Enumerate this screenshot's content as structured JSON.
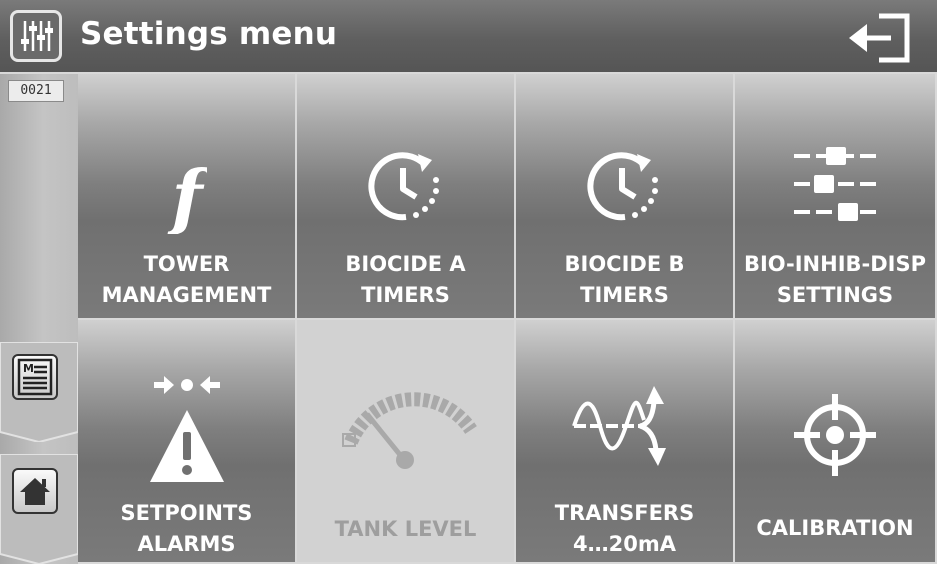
{
  "header": {
    "title": "Settings menu",
    "icon": "mixer-sliders-icon",
    "exit_icon": "exit-arrow-icon"
  },
  "sidebar": {
    "counter": "0021",
    "buttons": [
      {
        "icon": "manual-book-icon"
      },
      {
        "icon": "home-icon"
      }
    ]
  },
  "tiles": [
    {
      "line1": "TOWER",
      "line2": "MANAGEMENT",
      "icon": "function-f-icon",
      "enabled": true
    },
    {
      "line1": "BIOCIDE A",
      "line2": "TIMERS",
      "icon": "clock-timer-icon",
      "enabled": true
    },
    {
      "line1": "BIOCIDE B",
      "line2": "TIMERS",
      "icon": "clock-timer-icon",
      "enabled": true
    },
    {
      "line1": "BIO-INHIB-DISP",
      "line2": "SETTINGS",
      "icon": "sliders-icon",
      "enabled": true
    },
    {
      "line1": "SETPOINTS",
      "line2": "ALARMS",
      "icon": "warning-setpoint-icon",
      "enabled": true
    },
    {
      "line1": "TANK LEVEL",
      "line2": "",
      "icon": "gauge-icon",
      "enabled": false
    },
    {
      "line1": "TRANSFERS",
      "line2": "4…20mA",
      "icon": "signal-transfer-icon",
      "enabled": true
    },
    {
      "line1": "CALIBRATION",
      "line2": "",
      "icon": "crosshair-icon",
      "enabled": true
    }
  ]
}
